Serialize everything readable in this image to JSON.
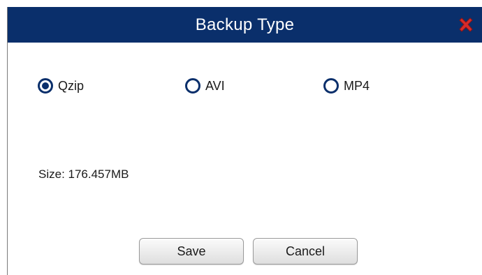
{
  "dialog": {
    "title": "Backup Type",
    "close_icon": "close-x-icon"
  },
  "backup_type": {
    "options": [
      {
        "label": "Qzip",
        "selected": true
      },
      {
        "label": "AVI",
        "selected": false
      },
      {
        "label": "MP4",
        "selected": false
      }
    ]
  },
  "size": {
    "text": "Size: 176.457MB"
  },
  "buttons": {
    "save_label": "Save",
    "cancel_label": "Cancel"
  },
  "colors": {
    "title_bar": "#0a2f6b",
    "close_icon": "#d62b2b",
    "radio": "#0a2f6b"
  }
}
